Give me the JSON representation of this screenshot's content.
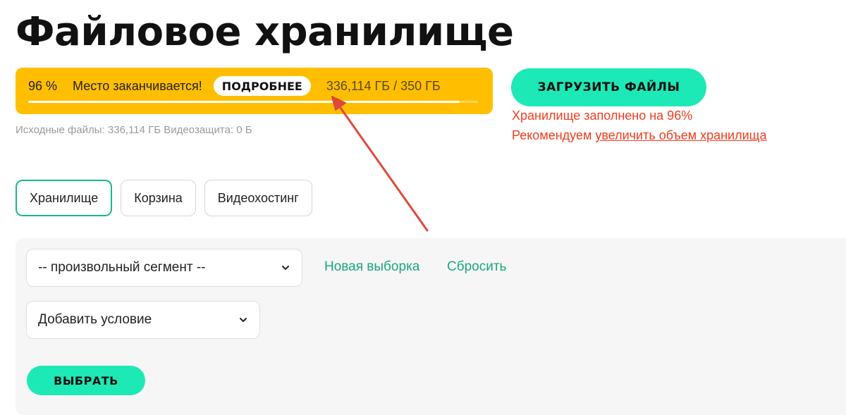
{
  "page": {
    "title": "Файловое хранилище"
  },
  "quota": {
    "percent_text": "96 %",
    "used_fraction": 0.96,
    "warning_text": "Место заканчивается!",
    "details_label": "ПОДРОБНЕЕ",
    "usage_text": "336,114 ГБ / 350 ГБ",
    "color": "#ffbf00"
  },
  "source_info": "Исходные файлы: 336,114 ГБ Видеозащита: 0 Б",
  "upload": {
    "label": "ЗАГРУЗИТЬ ФАЙЛЫ"
  },
  "alert": {
    "storage_full_text": "Хранилище заполнено на 96%",
    "recommend_prefix": "Рекомендуем ",
    "recommend_link": "увеличить объем хранилища",
    "color": "#f03c1e"
  },
  "tabs": [
    {
      "label": "Хранилище",
      "active": true
    },
    {
      "label": "Корзина",
      "active": false
    },
    {
      "label": "Видеохостинг",
      "active": false
    }
  ],
  "filters": {
    "segment_select_value": "-- произвольный сегмент --",
    "condition_select_value": "Добавить условие",
    "new_selection_label": "Новая выборка",
    "reset_label": "Сбросить",
    "select_button_label": "ВЫБРАТЬ"
  },
  "colors": {
    "accent": "#1de9b6",
    "link_green": "#19a77f",
    "annotation": "#e0483c"
  },
  "icons": {
    "select_chevron": "chevron-down-icon"
  }
}
